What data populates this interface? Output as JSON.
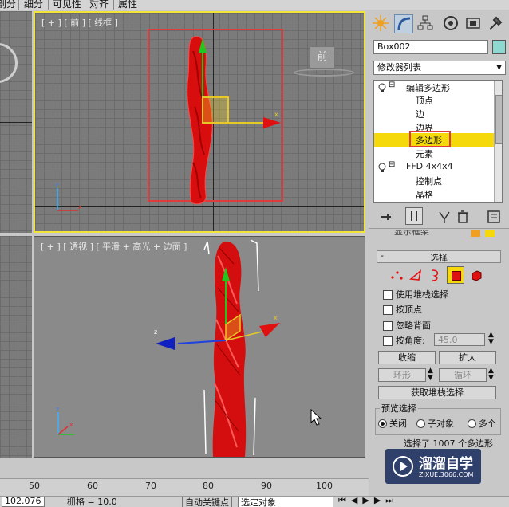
{
  "menubar": {
    "items": [
      "剖分",
      "细分",
      "可见性",
      "对齐",
      "属性"
    ]
  },
  "viewports": {
    "front": {
      "label": "[ + ] [ 前 ] [ 线框 ]",
      "viewcube_label": "前"
    },
    "perspective": {
      "label": "[ + ] [ 透视 ] [ 平滑 + 高光 + 边面 ]"
    }
  },
  "panel": {
    "object_name": "Box002",
    "modifier_list": "修改器列表",
    "stack": {
      "edit_poly": "编辑多边形",
      "vertex": "顶点",
      "edge": "边",
      "border": "边界",
      "polygon": "多边形",
      "element": "元素",
      "ffd": "FFD 4x4x4",
      "control_points": "控制点",
      "lattice": "晶格"
    },
    "show_cage_cut": "显示框架",
    "selection": {
      "title": "选择",
      "use_stack": "使用堆栈选择",
      "by_vertex": "按顶点",
      "ignore_backfacing": "忽略背面",
      "by_angle": "按角度:",
      "angle_value": "45.0",
      "shrink": "收缩",
      "grow": "扩大",
      "ring": "环形",
      "loop": "循环",
      "get_stack": "获取堆栈选择",
      "preview_title": "预览选择",
      "off": "关闭",
      "subobject": "子对象",
      "multi": "多个",
      "selected_info": "选择了 1007 个多边形"
    }
  },
  "ruler": {
    "ticks": [
      "50",
      "60",
      "70",
      "80",
      "90",
      "100"
    ]
  },
  "status": {
    "coord": "102.076",
    "grid": "栅格 = 10.0",
    "autokey": "自动关键点",
    "selected_object": "选定对象"
  },
  "watermark": {
    "title": "溜溜自学",
    "url": "ZIXUE.3066.COM"
  },
  "colors": {
    "object_red": "#e01010",
    "active_border": "#f2e43a",
    "highlight": "#f5d90a",
    "select_box": "#e03a3a"
  }
}
